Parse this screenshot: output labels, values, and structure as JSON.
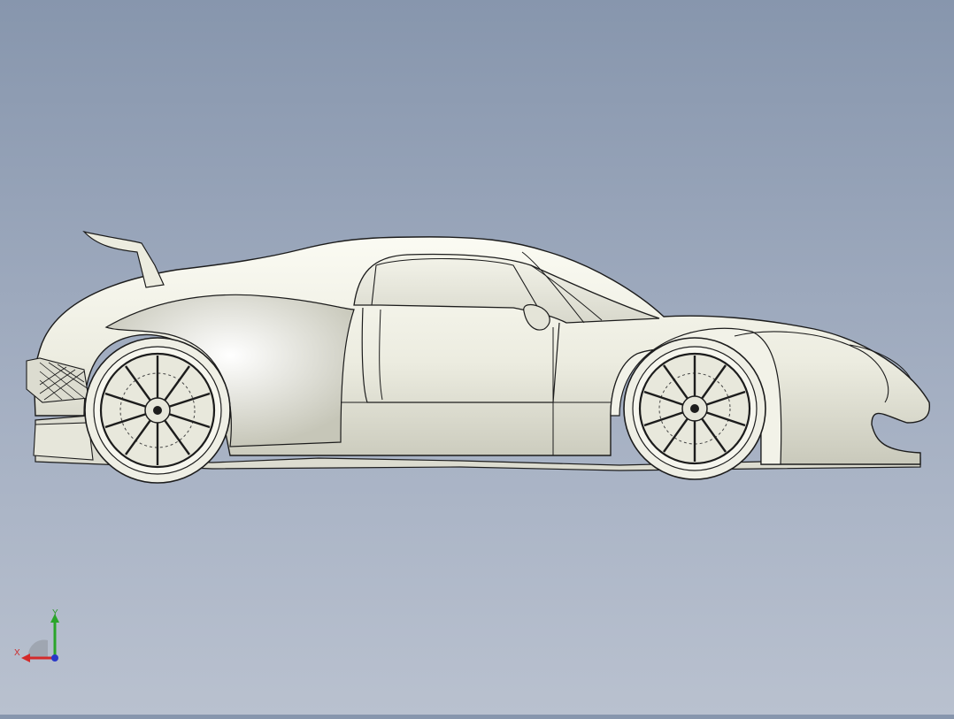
{
  "viewport": {
    "background_top": "#8796ad",
    "background_bottom": "#b9c1cf",
    "model": {
      "body_color": "#f0f0e6",
      "edge_color": "#1c1c1c"
    }
  },
  "triad": {
    "x_label": "X",
    "y_label": "Y",
    "x_color": "#d42a2a",
    "y_color": "#2aa52a",
    "z_color": "#2a38c8"
  }
}
